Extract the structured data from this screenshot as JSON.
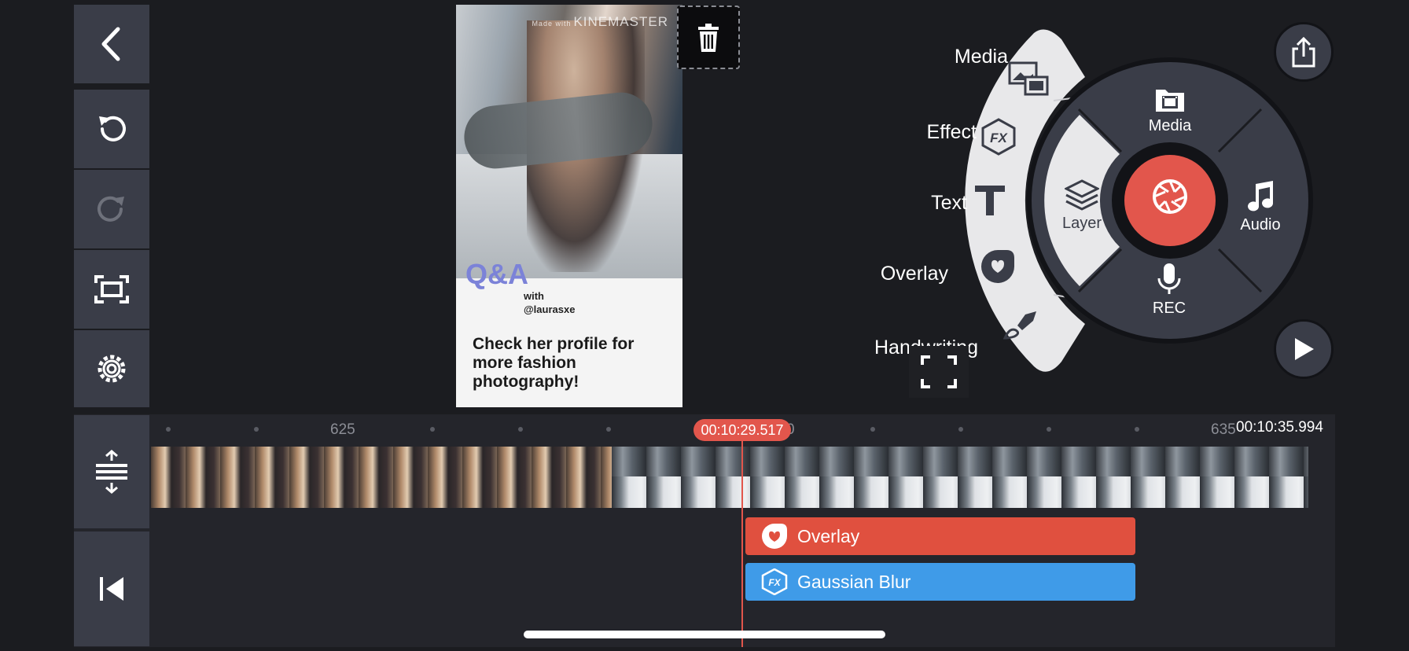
{
  "toolbar": {
    "icons": [
      "back-icon",
      "undo-icon",
      "redo-icon",
      "crop-icon",
      "settings-icon",
      "expand-tracks-icon",
      "jump-to-start-icon"
    ]
  },
  "preview": {
    "watermark_small": "Made with",
    "watermark": "KINEMASTER",
    "qa_title": "Q&A",
    "with_line1": "with",
    "with_line2": "@laurasxe",
    "card_text": "Check her profile for more fashion photography!"
  },
  "media_fan": {
    "items": [
      {
        "label": "Media",
        "icon": "media-library-icon"
      },
      {
        "label": "Effect",
        "icon": "fx-icon"
      },
      {
        "label": "Text",
        "icon": "text-icon"
      },
      {
        "label": "Overlay",
        "icon": "sticker-icon"
      },
      {
        "label": "Handwriting",
        "icon": "brush-icon"
      }
    ]
  },
  "wheel": {
    "media": "Media",
    "layer": "Layer",
    "audio": "Audio",
    "rec": "REC",
    "accent": "#e2564c"
  },
  "timeline": {
    "ruler_labels": [
      "625",
      "0",
      "635"
    ],
    "current_time": "00:10:29.517",
    "end_time": "00:10:35.994",
    "layers": [
      {
        "label": "Overlay",
        "color": "#e0503f",
        "icon": "sticker-icon"
      },
      {
        "label": "Gaussian Blur",
        "color": "#3f9be8",
        "icon": "fx-icon"
      }
    ]
  }
}
